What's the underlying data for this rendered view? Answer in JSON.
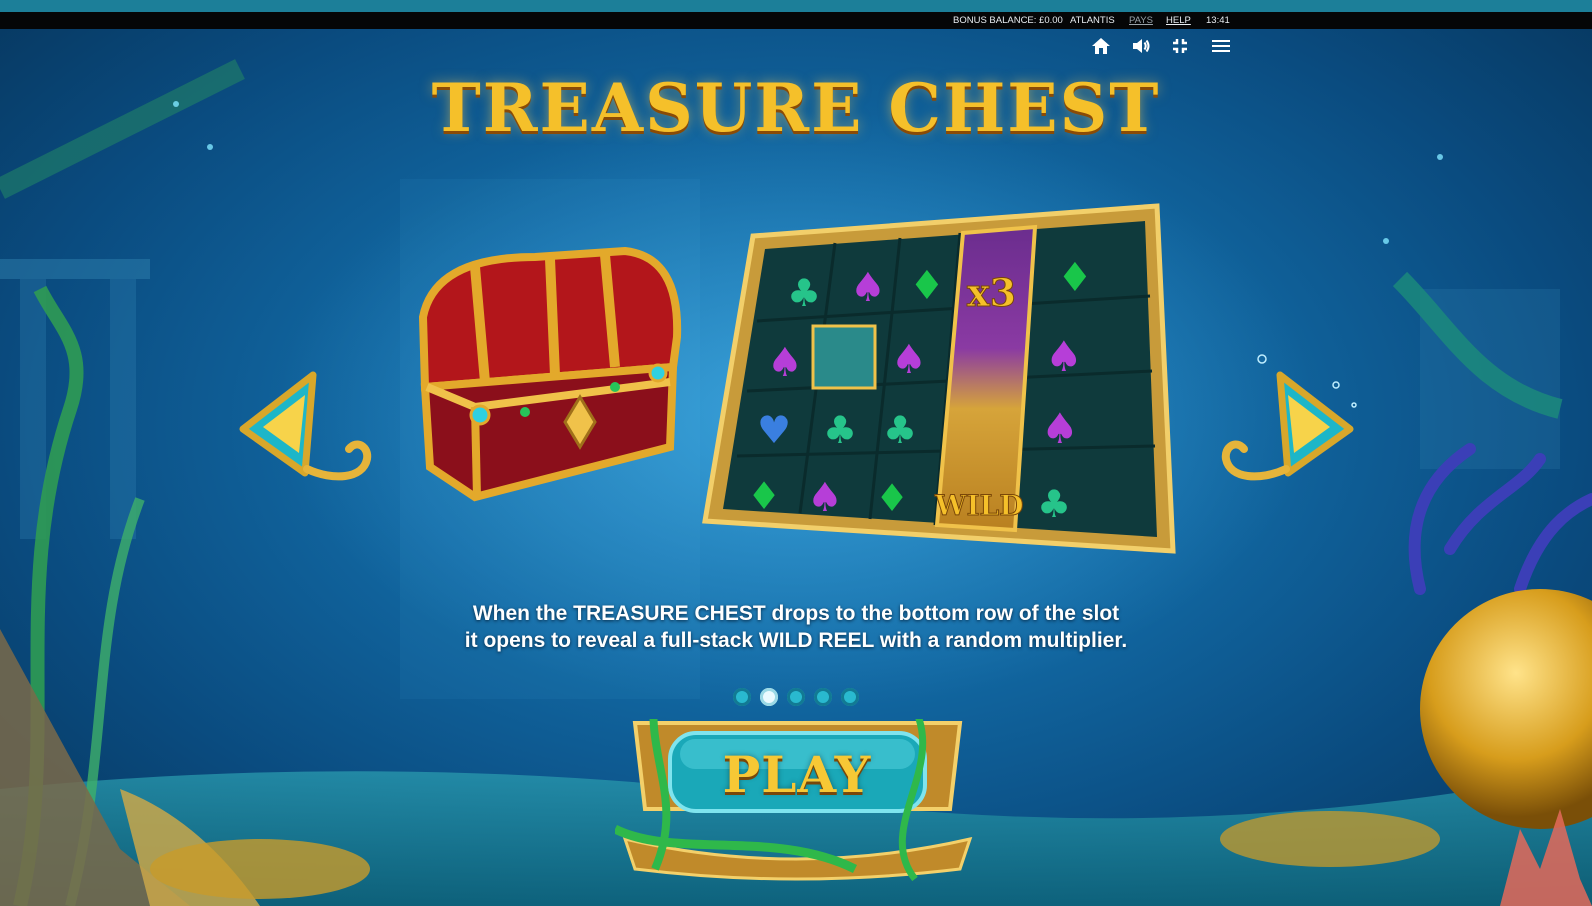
{
  "infobar": {
    "bonus_balance": "BONUS BALANCE: £0.00",
    "game_name": "ATLANTIS",
    "pays": "PAYS",
    "help": "HELP",
    "clock": "13:41"
  },
  "controls": [
    "home-icon",
    "volume-icon",
    "exit-fullscreen-icon",
    "menu-icon"
  ],
  "slide": {
    "title": "TREASURE CHEST",
    "caption_line1": "When the TREASURE CHEST drops to the bottom row of the slot",
    "caption_line2": "it opens to reveal a full-stack WILD REEL with a random multiplier.",
    "reel_multiplier": "x3",
    "wild_label": "WILD"
  },
  "pagination": {
    "total": 5,
    "active_index": 1
  },
  "play_button": {
    "label": "PLAY"
  },
  "colors": {
    "gold": "#f5c02a",
    "turquoise": "#1fb7c9",
    "ocean": "#126aa5",
    "bar": "#050607"
  }
}
